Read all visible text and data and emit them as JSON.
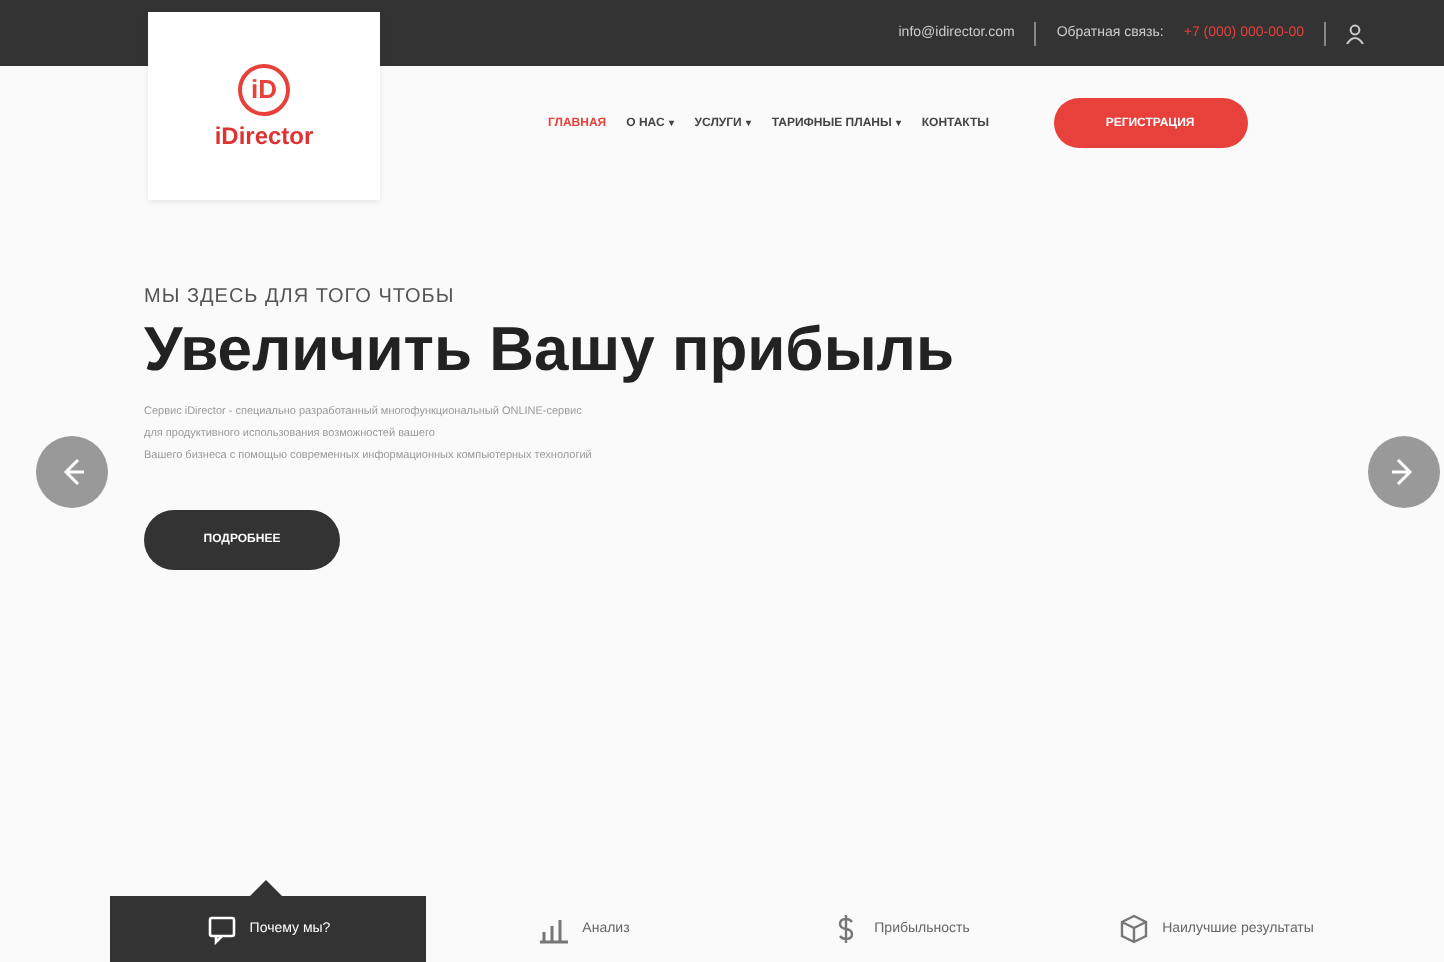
{
  "top_bar": {
    "email": "info@idirector.com",
    "feedback_label": "Обратная связь:",
    "phone": "+7 (000) 000-00-00"
  },
  "logo": {
    "text": "iDirector",
    "mark": "iD"
  },
  "nav": {
    "items": [
      {
        "label": "ГЛАВНАЯ",
        "selected": true
      },
      {
        "label": "О НАС",
        "selected": false,
        "caret": "▾"
      },
      {
        "label": "УСЛУГИ",
        "selected": false,
        "caret": "▾"
      },
      {
        "label": "ТАРИФНЫЕ ПЛАНЫ",
        "selected": false,
        "caret": "▾"
      },
      {
        "label": "КОНТАКТЫ",
        "selected": false
      }
    ],
    "register_button": "РЕГИСТРАЦИЯ"
  },
  "hero": {
    "kicker": "МЫ ЗДЕСЬ ДЛЯ ТОГО ЧТОБЫ",
    "title": "Увеличить Вашу прибыль",
    "lines": [
      "Сервис iDirector - специально разработанный многофункциональный ONLINE-сервис",
      "для продуктивного использования возможностей вашего",
      "Вашего бизнеса с помощью современных информационных компьютерных технологий"
    ],
    "button": "ПОДРОБНЕЕ"
  },
  "feature_tabs": [
    {
      "label": "Почему мы?",
      "selected": true,
      "kind": "chat"
    },
    {
      "label": "Анализ",
      "selected": false,
      "kind": "chart"
    },
    {
      "label": "Прибыльность",
      "selected": false,
      "kind": "dollar"
    },
    {
      "label": "Наилучшие результаты",
      "selected": false,
      "kind": "box"
    }
  ]
}
